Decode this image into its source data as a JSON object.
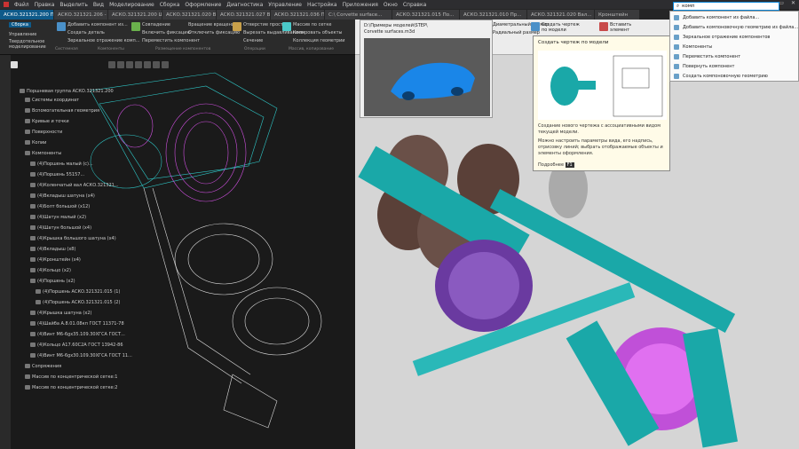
{
  "menu": [
    "Файл",
    "Правка",
    "Выделить",
    "Вид",
    "Моделирование",
    "Сборка",
    "Оформление",
    "Диагностика",
    "Управление",
    "Настройка",
    "Приложения",
    "Окно",
    "Справка"
  ],
  "tabs": [
    "АСКО.321321.200 Пор...",
    "АСКО.321321.206 - Кр...",
    "АСКО.321321.200 Шп...",
    "АСКО.321321.020 Вал...",
    "АСКО.321321.027 Вал...",
    "АСКО.321321.036 Пр...",
    "C:\\ Corvette surface...",
    "АСКО.321321.015 По...",
    "АСКО.321321.010 Пр...",
    "АСКО.321321.020 Вал...",
    "Кронштейн"
  ],
  "ribbon": {
    "left_commands": [
      "Сборка",
      "Управление",
      "Твердотельное моделирование",
      "Добавить компонент из...",
      "Создать деталь",
      "Зеркальное отражение комп...",
      "Совпадение",
      "Включить фиксацию",
      "Переместить компонент",
      "Вращение вращение",
      "Отключить фиксацию",
      "Отверстие простое",
      "Вырезать выдавливанием",
      "Сечение",
      "Массив по сетке",
      "Копировать объекты",
      "Коллекция геометрии"
    ],
    "groups": [
      "Системная",
      "Компоненты",
      "Размещение компонентов",
      "Операции",
      "Массив, копирование"
    ],
    "right_commands": [
      "Диаметральный размер",
      "Радиальный размер",
      "Создать чертеж по модели",
      "Вставить элемент"
    ]
  },
  "model_popup": {
    "path_line1": "D:\\Примеры моделей\\STEP\\",
    "path_line2": "Corvette surfaces.m3d"
  },
  "tooltip": {
    "title": "Создать чертеж по модели",
    "desc1": "Создание нового чертежа с ассоциативными видом текущей модели.",
    "desc2": "Можно настроить параметры вида, его надпись, отрисовку линий; выбрать отображаемые объекты и элементы оформления.",
    "more": "Подробнее",
    "key": "F1"
  },
  "search": {
    "value": "комп"
  },
  "dropdown": [
    "Добавить компонент из файла...",
    "Добавить компоновочную геометрию из файла...",
    "Зеркальное отражение компонентов",
    "Компоненты",
    "Переместить компонент",
    "Повернуть компонент",
    "Создать компоновочную геометрию"
  ],
  "tree": [
    "Поршневая группа АСКО.321321.200",
    "Системы координат",
    "Вспомогательная геометрия",
    "Кривые и точки",
    "Поверхности",
    "Копии",
    "Компоненты",
    "(4)Поршень малый (с)...",
    "(4)Поршень 55157...",
    "(4)Коленчатый вал АСКО.321321...",
    "(4)Вкладыш шатуна (x4)",
    "(4)Болт большой (x12)",
    "(4)Шатун малый (x2)",
    "(4)Шатун большой (x4)",
    "(4)Крышка большого шатуна (x4)",
    "(4)Вкладыш (x8)",
    "(4)Кронштейн (x4)",
    "(4)Кольцо (x2)",
    "(4)Поршень (x2)",
    "(4)Поршень АСКО.321321.015 (1)",
    "(4)Поршень АСКО.321321.015 (2)",
    "(4)Крышка шатуна (x2)",
    "(4)Шайба А.8.01.08кп ГОСТ 11371-78",
    "(4)Винт М6-6gx35.109.30ХГСА ГОСТ...",
    "(4)Кольцо А17.60С2А ГОСТ 13942-86",
    "(4)Винт М6-6gx30.109.30ХГСА ГОСТ 11...",
    "Сопряжения",
    "Массив по концентрической сетке:1",
    "Массив по концентрической сетке:2"
  ],
  "colors": {
    "accent": "#0e5a8a",
    "teal": "#1aa8a8",
    "magenta": "#d050e0",
    "purple": "#7040a0"
  }
}
